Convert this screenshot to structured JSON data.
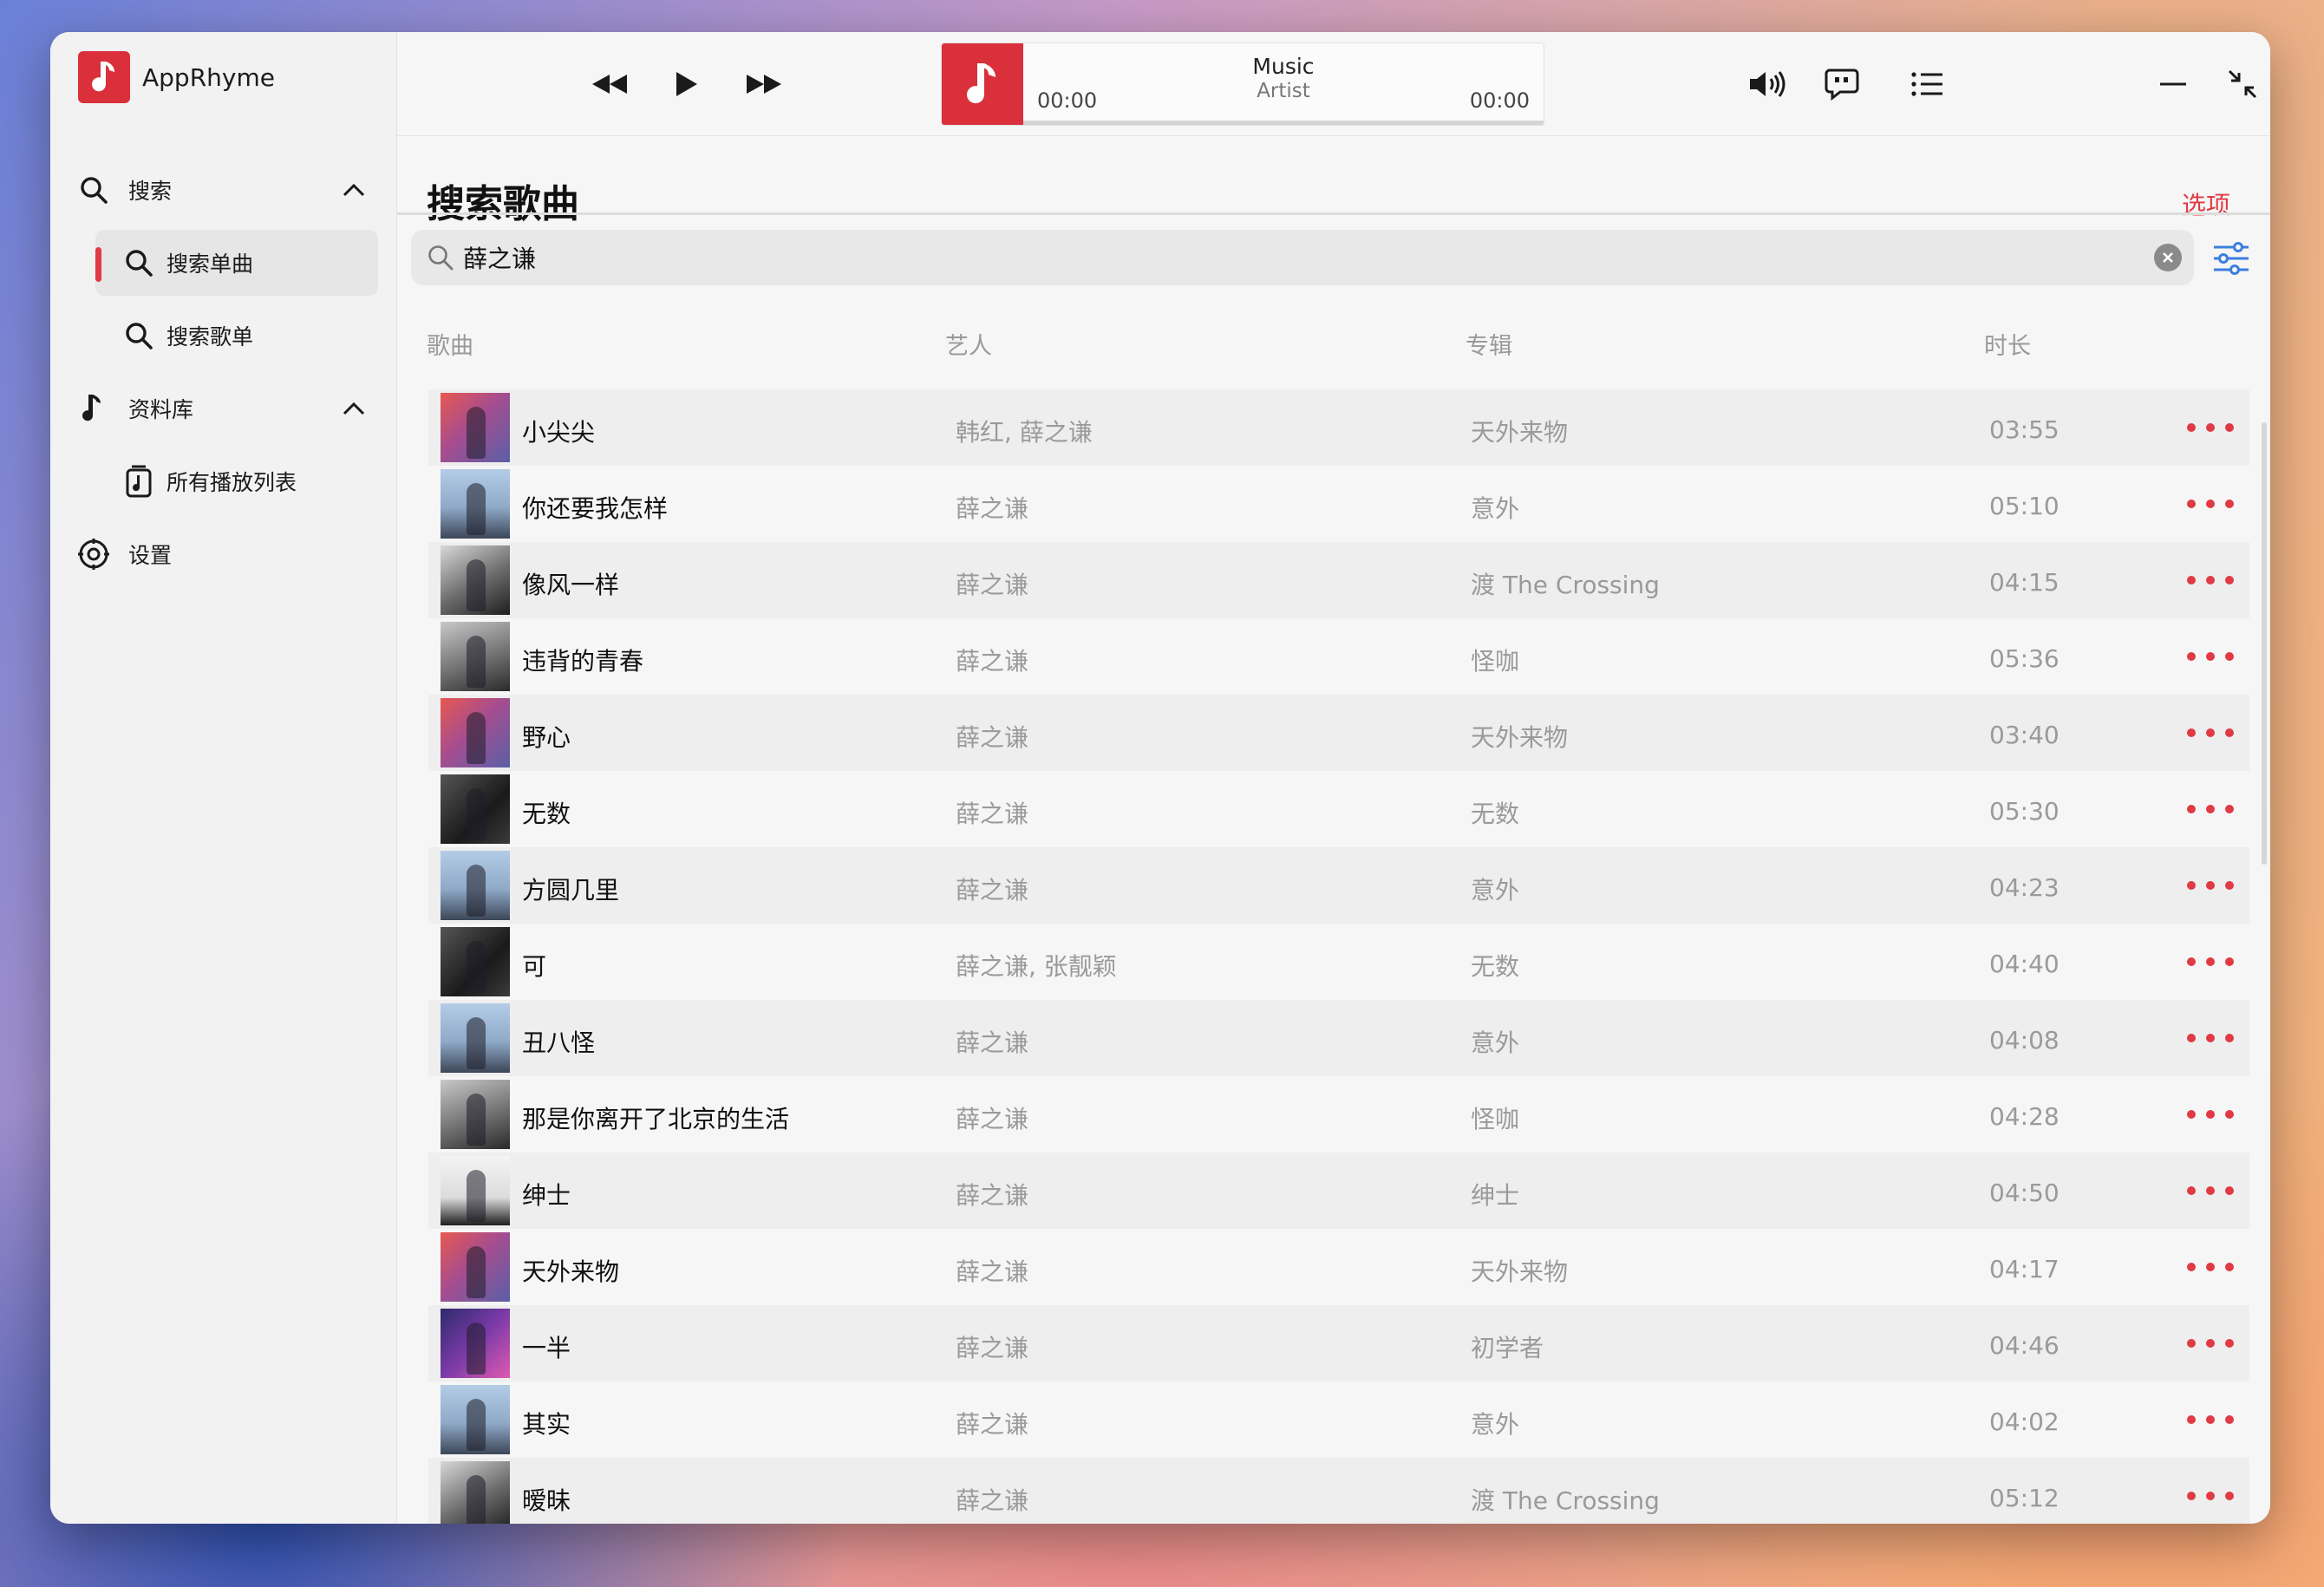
{
  "app": {
    "name": "AppRhyme"
  },
  "sidebar": {
    "search": {
      "label": "搜索"
    },
    "search_songs": {
      "label": "搜索单曲"
    },
    "search_playlists": {
      "label": "搜索歌单"
    },
    "library": {
      "label": "资料库"
    },
    "all_playlists": {
      "label": "所有播放列表"
    },
    "settings": {
      "label": "设置"
    }
  },
  "player": {
    "title": "Music",
    "artist": "Artist",
    "elapsed": "00:00",
    "duration": "00:00",
    "progress": 0
  },
  "page": {
    "title": "搜索歌曲",
    "options_label": "选项"
  },
  "search": {
    "value": "薛之谦"
  },
  "columns": {
    "song": "歌曲",
    "artist": "艺人",
    "album": "专辑",
    "duration": "时长"
  },
  "songs": [
    {
      "title": "小尖尖",
      "artist": "韩红, 薛之谦",
      "album": "天外来物",
      "duration": "03:55",
      "art": "a"
    },
    {
      "title": "你还要我怎样",
      "artist": "薛之谦",
      "album": "意外",
      "duration": "05:10",
      "art": "b"
    },
    {
      "title": "像风一样",
      "artist": "薛之谦",
      "album": "渡 The Crossing",
      "duration": "04:15",
      "art": "c"
    },
    {
      "title": "违背的青春",
      "artist": "薛之谦",
      "album": "怪咖",
      "duration": "05:36",
      "art": "d"
    },
    {
      "title": "野心",
      "artist": "薛之谦",
      "album": "天外来物",
      "duration": "03:40",
      "art": "a"
    },
    {
      "title": "无数",
      "artist": "薛之谦",
      "album": "无数",
      "duration": "05:30",
      "art": "e"
    },
    {
      "title": "方圆几里",
      "artist": "薛之谦",
      "album": "意外",
      "duration": "04:23",
      "art": "b"
    },
    {
      "title": "可",
      "artist": "薛之谦, 张靓颖",
      "album": "无数",
      "duration": "04:40",
      "art": "e"
    },
    {
      "title": "丑八怪",
      "artist": "薛之谦",
      "album": "意外",
      "duration": "04:08",
      "art": "b"
    },
    {
      "title": "那是你离开了北京的生活",
      "artist": "薛之谦",
      "album": "怪咖",
      "duration": "04:28",
      "art": "d"
    },
    {
      "title": "绅士",
      "artist": "薛之谦",
      "album": "绅士",
      "duration": "04:50",
      "art": "f"
    },
    {
      "title": "天外来物",
      "artist": "薛之谦",
      "album": "天外来物",
      "duration": "04:17",
      "art": "a"
    },
    {
      "title": "一半",
      "artist": "薛之谦",
      "album": "初学者",
      "duration": "04:46",
      "art": "g"
    },
    {
      "title": "其实",
      "artist": "薛之谦",
      "album": "意外",
      "duration": "04:02",
      "art": "b"
    },
    {
      "title": "暧昧",
      "artist": "薛之谦",
      "album": "渡 The Crossing",
      "duration": "05:12",
      "art": "c"
    }
  ],
  "colors": {
    "accent": "#e03a44",
    "filter_icon": "#3b7fe0"
  },
  "icons": {
    "logo": "music-note-icon",
    "prev": "rewind-icon",
    "play": "play-icon",
    "next": "fast-forward-icon",
    "volume": "volume-icon",
    "lyrics": "lyrics-bubble-icon",
    "queue": "list-icon",
    "minimize": "minimize-icon",
    "shrink": "shrink-icon",
    "close": "close-icon"
  }
}
